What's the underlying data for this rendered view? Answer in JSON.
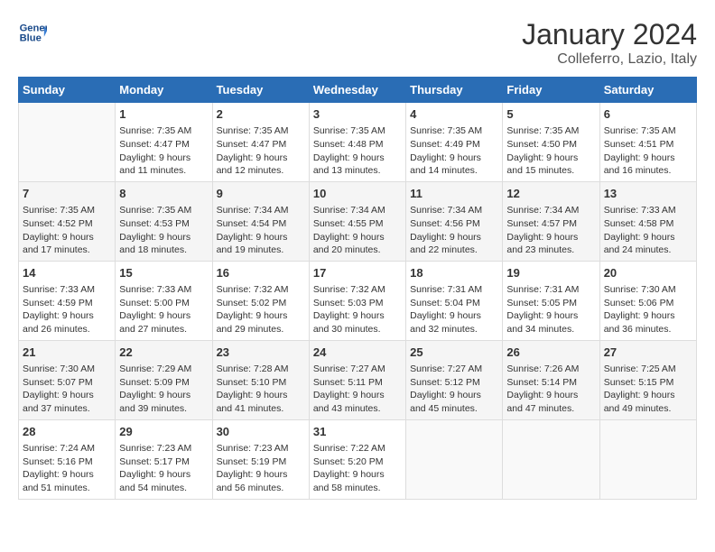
{
  "header": {
    "logo_line1": "General",
    "logo_line2": "Blue",
    "month_title": "January 2024",
    "location": "Colleferro, Lazio, Italy"
  },
  "columns": [
    "Sunday",
    "Monday",
    "Tuesday",
    "Wednesday",
    "Thursday",
    "Friday",
    "Saturday"
  ],
  "weeks": [
    [
      {
        "day": "",
        "info": ""
      },
      {
        "day": "1",
        "info": "Sunrise: 7:35 AM\nSunset: 4:47 PM\nDaylight: 9 hours\nand 11 minutes."
      },
      {
        "day": "2",
        "info": "Sunrise: 7:35 AM\nSunset: 4:47 PM\nDaylight: 9 hours\nand 12 minutes."
      },
      {
        "day": "3",
        "info": "Sunrise: 7:35 AM\nSunset: 4:48 PM\nDaylight: 9 hours\nand 13 minutes."
      },
      {
        "day": "4",
        "info": "Sunrise: 7:35 AM\nSunset: 4:49 PM\nDaylight: 9 hours\nand 14 minutes."
      },
      {
        "day": "5",
        "info": "Sunrise: 7:35 AM\nSunset: 4:50 PM\nDaylight: 9 hours\nand 15 minutes."
      },
      {
        "day": "6",
        "info": "Sunrise: 7:35 AM\nSunset: 4:51 PM\nDaylight: 9 hours\nand 16 minutes."
      }
    ],
    [
      {
        "day": "7",
        "info": "Sunrise: 7:35 AM\nSunset: 4:52 PM\nDaylight: 9 hours\nand 17 minutes."
      },
      {
        "day": "8",
        "info": "Sunrise: 7:35 AM\nSunset: 4:53 PM\nDaylight: 9 hours\nand 18 minutes."
      },
      {
        "day": "9",
        "info": "Sunrise: 7:34 AM\nSunset: 4:54 PM\nDaylight: 9 hours\nand 19 minutes."
      },
      {
        "day": "10",
        "info": "Sunrise: 7:34 AM\nSunset: 4:55 PM\nDaylight: 9 hours\nand 20 minutes."
      },
      {
        "day": "11",
        "info": "Sunrise: 7:34 AM\nSunset: 4:56 PM\nDaylight: 9 hours\nand 22 minutes."
      },
      {
        "day": "12",
        "info": "Sunrise: 7:34 AM\nSunset: 4:57 PM\nDaylight: 9 hours\nand 23 minutes."
      },
      {
        "day": "13",
        "info": "Sunrise: 7:33 AM\nSunset: 4:58 PM\nDaylight: 9 hours\nand 24 minutes."
      }
    ],
    [
      {
        "day": "14",
        "info": "Sunrise: 7:33 AM\nSunset: 4:59 PM\nDaylight: 9 hours\nand 26 minutes."
      },
      {
        "day": "15",
        "info": "Sunrise: 7:33 AM\nSunset: 5:00 PM\nDaylight: 9 hours\nand 27 minutes."
      },
      {
        "day": "16",
        "info": "Sunrise: 7:32 AM\nSunset: 5:02 PM\nDaylight: 9 hours\nand 29 minutes."
      },
      {
        "day": "17",
        "info": "Sunrise: 7:32 AM\nSunset: 5:03 PM\nDaylight: 9 hours\nand 30 minutes."
      },
      {
        "day": "18",
        "info": "Sunrise: 7:31 AM\nSunset: 5:04 PM\nDaylight: 9 hours\nand 32 minutes."
      },
      {
        "day": "19",
        "info": "Sunrise: 7:31 AM\nSunset: 5:05 PM\nDaylight: 9 hours\nand 34 minutes."
      },
      {
        "day": "20",
        "info": "Sunrise: 7:30 AM\nSunset: 5:06 PM\nDaylight: 9 hours\nand 36 minutes."
      }
    ],
    [
      {
        "day": "21",
        "info": "Sunrise: 7:30 AM\nSunset: 5:07 PM\nDaylight: 9 hours\nand 37 minutes."
      },
      {
        "day": "22",
        "info": "Sunrise: 7:29 AM\nSunset: 5:09 PM\nDaylight: 9 hours\nand 39 minutes."
      },
      {
        "day": "23",
        "info": "Sunrise: 7:28 AM\nSunset: 5:10 PM\nDaylight: 9 hours\nand 41 minutes."
      },
      {
        "day": "24",
        "info": "Sunrise: 7:27 AM\nSunset: 5:11 PM\nDaylight: 9 hours\nand 43 minutes."
      },
      {
        "day": "25",
        "info": "Sunrise: 7:27 AM\nSunset: 5:12 PM\nDaylight: 9 hours\nand 45 minutes."
      },
      {
        "day": "26",
        "info": "Sunrise: 7:26 AM\nSunset: 5:14 PM\nDaylight: 9 hours\nand 47 minutes."
      },
      {
        "day": "27",
        "info": "Sunrise: 7:25 AM\nSunset: 5:15 PM\nDaylight: 9 hours\nand 49 minutes."
      }
    ],
    [
      {
        "day": "28",
        "info": "Sunrise: 7:24 AM\nSunset: 5:16 PM\nDaylight: 9 hours\nand 51 minutes."
      },
      {
        "day": "29",
        "info": "Sunrise: 7:23 AM\nSunset: 5:17 PM\nDaylight: 9 hours\nand 54 minutes."
      },
      {
        "day": "30",
        "info": "Sunrise: 7:23 AM\nSunset: 5:19 PM\nDaylight: 9 hours\nand 56 minutes."
      },
      {
        "day": "31",
        "info": "Sunrise: 7:22 AM\nSunset: 5:20 PM\nDaylight: 9 hours\nand 58 minutes."
      },
      {
        "day": "",
        "info": ""
      },
      {
        "day": "",
        "info": ""
      },
      {
        "day": "",
        "info": ""
      }
    ]
  ]
}
